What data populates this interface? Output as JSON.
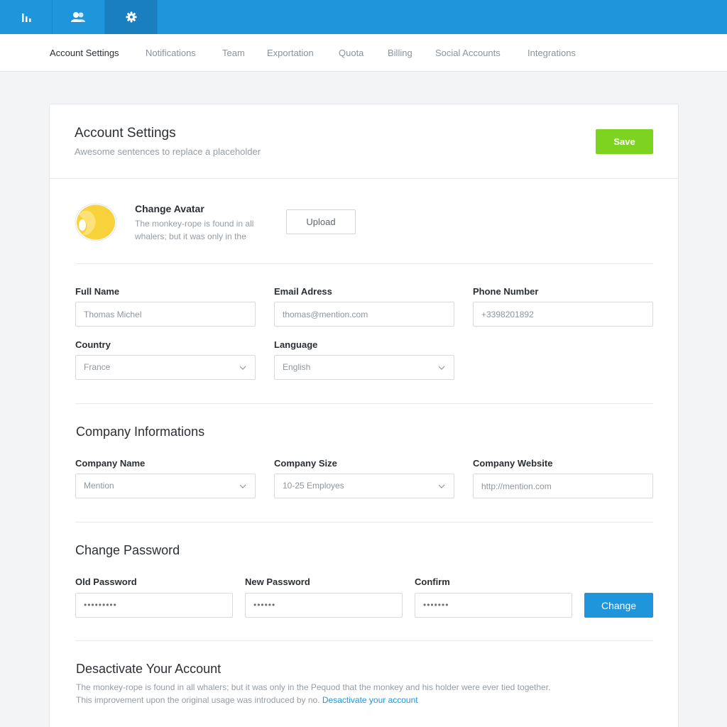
{
  "topbar": {
    "items": [
      {
        "icon": "bar-chart-icon"
      },
      {
        "icon": "users-icon"
      },
      {
        "icon": "gear-icon",
        "active": true
      }
    ]
  },
  "tabs": [
    {
      "label": "Account Settings",
      "active": true
    },
    {
      "label": "Notifications"
    },
    {
      "label": "Team"
    },
    {
      "label": "Exportation"
    },
    {
      "label": "Quota"
    },
    {
      "label": "Billing"
    },
    {
      "label": "Social Accounts"
    },
    {
      "label": "Integrations"
    }
  ],
  "header": {
    "title": "Account Settings",
    "subtitle": "Awesome sentences to replace a placeholder",
    "save_label": "Save"
  },
  "avatar": {
    "title": "Change Avatar",
    "description": "The monkey-rope is found in all whalers; but it was only in the",
    "upload_label": "Upload"
  },
  "profile": {
    "full_name_label": "Full Name",
    "full_name_value": "Thomas Michel",
    "email_label": "Email Adress",
    "email_value": "thomas@mention.com",
    "phone_label": "Phone Number",
    "phone_value": "+3398201892",
    "country_label": "Country",
    "country_value": "France",
    "language_label": "Language",
    "language_value": "English"
  },
  "company": {
    "title": "Company Informations",
    "name_label": "Company Name",
    "name_value": "Mention",
    "size_label": "Company Size",
    "size_value": "10-25 Employes",
    "website_label": "Company Website",
    "website_value": "http://mention.com"
  },
  "password": {
    "title": "Change Password",
    "old_label": "Old Password",
    "old_value": "•••••••••",
    "new_label": "New Password",
    "new_value": "••••••",
    "confirm_label": "Confirm",
    "confirm_value": "•••••••",
    "change_label": "Change"
  },
  "deactivate": {
    "title": "Desactivate Your Account",
    "text_line1": "The monkey-rope is found in all whalers; but it was only in the Pequod that the monkey and his holder were ever tied together.",
    "text_line2": "This improvement upon the original usage was introduced by no.",
    "link_label": "Desactivate your account"
  },
  "colors": {
    "brand_blue": "#1f96dc",
    "save_green": "#7ed321",
    "avatar_yellow": "#f7d23a"
  }
}
